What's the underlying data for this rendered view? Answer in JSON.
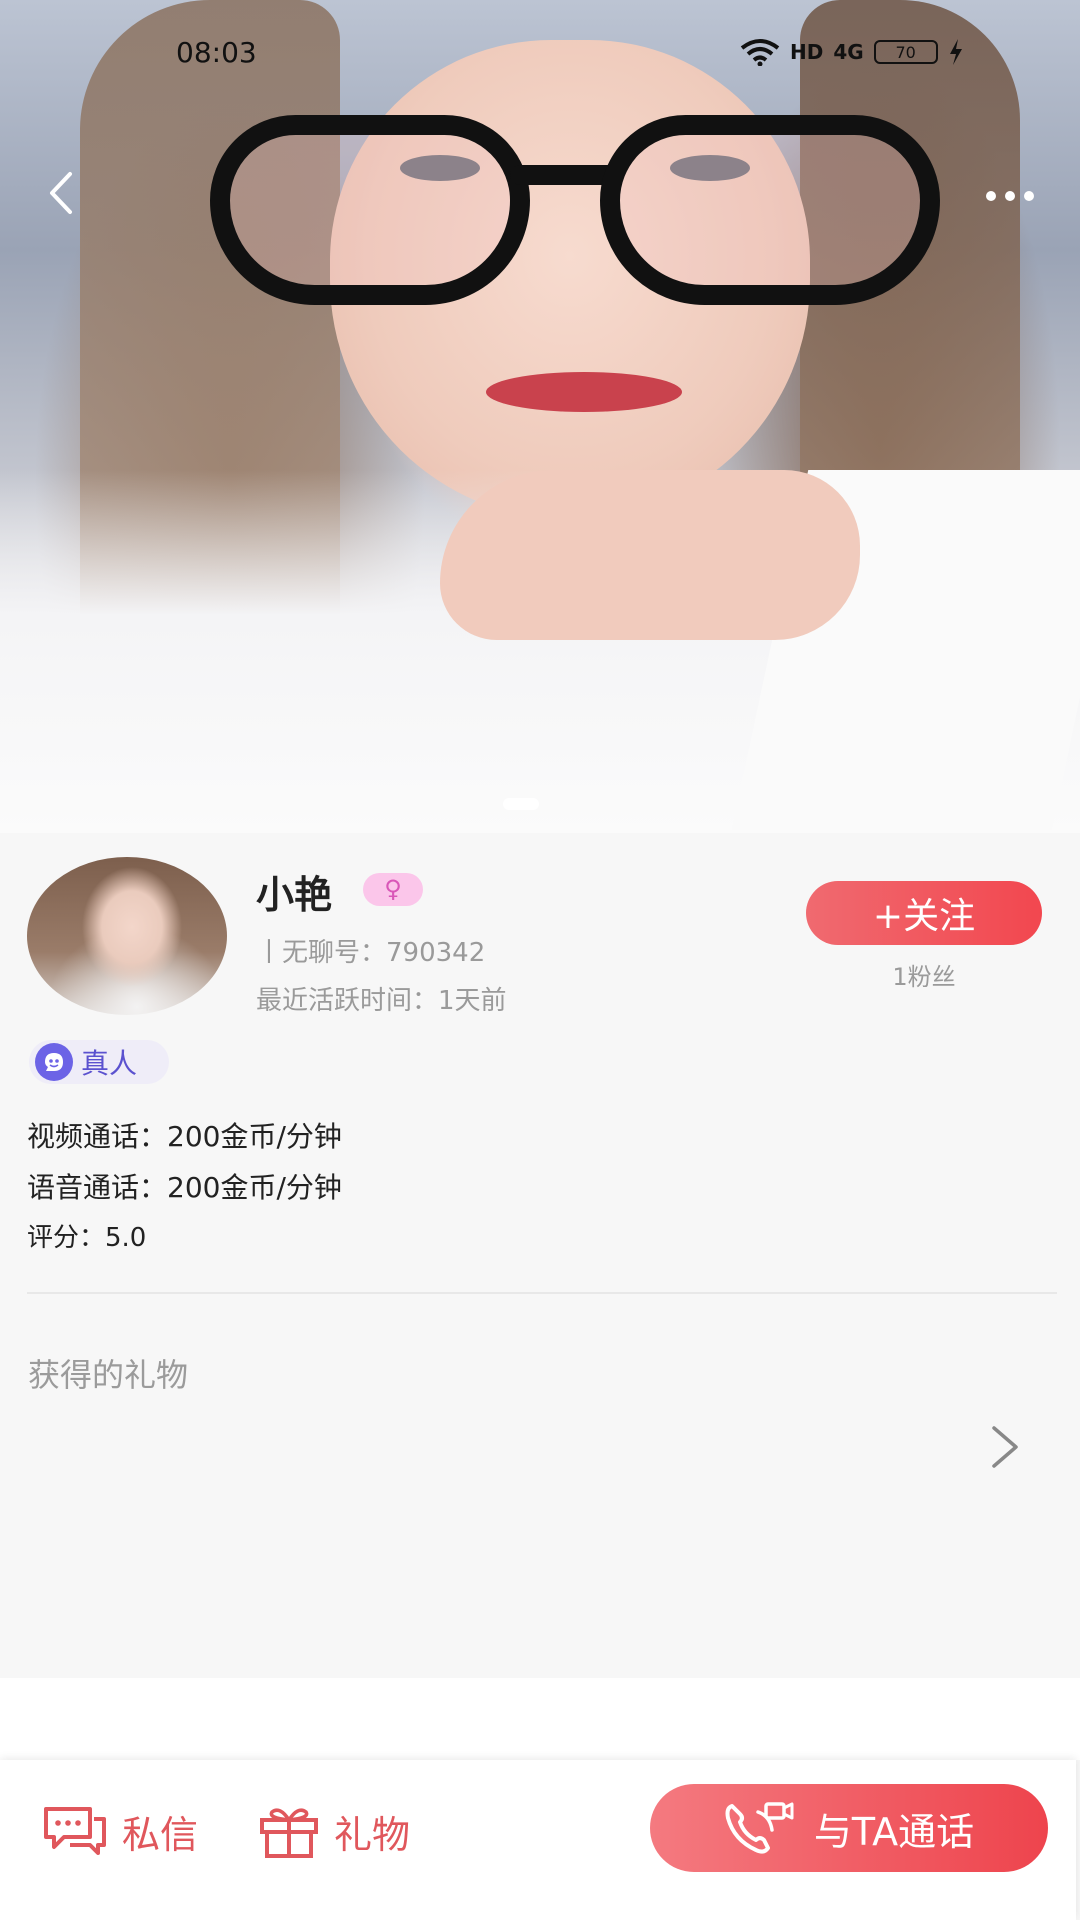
{
  "status_bar": {
    "time": "08:03",
    "network": "HD",
    "cellular": "4G",
    "battery": "70"
  },
  "profile": {
    "name": "小艳",
    "gender_symbol": "♀",
    "user_id": "丨无聊号：790342",
    "active_time": "最近活跃时间：1天前",
    "follow_label": "+关注",
    "fans": "1粉丝",
    "real_badge": "真人"
  },
  "info": {
    "video_call": "视频通话：200金币/分钟",
    "voice_call": "语音通话：200金币/分钟",
    "rating": "评分：5.0"
  },
  "gifts": {
    "title": "获得的礼物"
  },
  "bottom_bar": {
    "message_label": "私信",
    "gift_label": "礼物",
    "call_label": "与TA通话"
  },
  "colors": {
    "accent": "#f2474f",
    "badge_pink": "#fbc6ea",
    "real_purple": "#6c63e6"
  }
}
